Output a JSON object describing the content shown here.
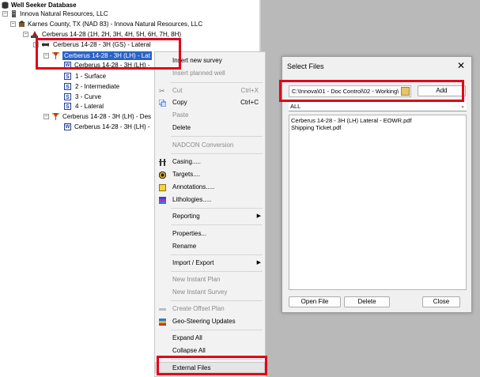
{
  "tree": {
    "root": "Well Seeker Database",
    "operator": "Innova Natural Resources, LLC",
    "county": "Karnes County, TX (NAD 83) - Innova Natural Resources, LLC",
    "pad": "Cerberus 14-28 (1H, 2H, 3H, 4H, 5H, 6H, 7H, 8H)",
    "well": "Cerberus 14-28 - 3H (GS) - Lateral",
    "wellbore_selected": "Cerberus 14-28 - 3H (LH) - Lat",
    "survey_1": "Cerberus 14-28 - 3H (LH) -",
    "sections": [
      "1 - Surface",
      "2 - Intermediate",
      "3 - Curve",
      "4 - Lateral"
    ],
    "design": "Cerberus 14-28 - 3H (LH) - Des",
    "design_survey": "Cerberus 14-28 - 3H (LH) -"
  },
  "icons": {
    "database": "database-icon",
    "operator": "operator-icon",
    "county": "county-icon",
    "pad": "pad-icon",
    "well": "well-icon",
    "wellbore": "wellbore-icon",
    "survey": "survey-w-icon",
    "section": "section-s-icon"
  },
  "context_menu": {
    "insert_new_survey": "Insert new survey",
    "insert_planned_well": "Insert planned well",
    "cut": "Cut",
    "cut_shortcut": "Ctrl+X",
    "copy": "Copy",
    "copy_shortcut": "Ctrl+C",
    "paste": "Paste",
    "delete": "Delete",
    "nadcon": "NADCON Conversion",
    "casing": "Casing.....",
    "targets": "Targets....",
    "annotations": "Annotations.....",
    "lithologies": "Lithologies.....",
    "reporting": "Reporting",
    "properties": "Properties...",
    "rename": "Rename",
    "import_export": "Import / Export",
    "new_instant_plan": "New Instant Plan",
    "new_instant_survey": "New Instant Survey",
    "create_offset_plan": "Create Offset Plan",
    "geo_steering": "Geo-Steering Updates",
    "expand_all": "Expand All",
    "collapse_all": "Collapse All",
    "external_files": "External Files"
  },
  "dialog": {
    "title": "Select Files",
    "close": "✕",
    "path": "C:\\Innova\\01 - Doc Control\\02 - Working\\",
    "add": "Add",
    "filter": "ALL",
    "files": [
      "Cerberus 14-28 - 3H (LH) Lateral - EOWR.pdf",
      "Shipping Ticket.pdf"
    ],
    "open_file": "Open File",
    "delete": "Delete",
    "close_button": "Close"
  },
  "colors": {
    "highlight": "#e1001a",
    "selection": "#2a63c6",
    "background_right": "#b9b9b9"
  }
}
